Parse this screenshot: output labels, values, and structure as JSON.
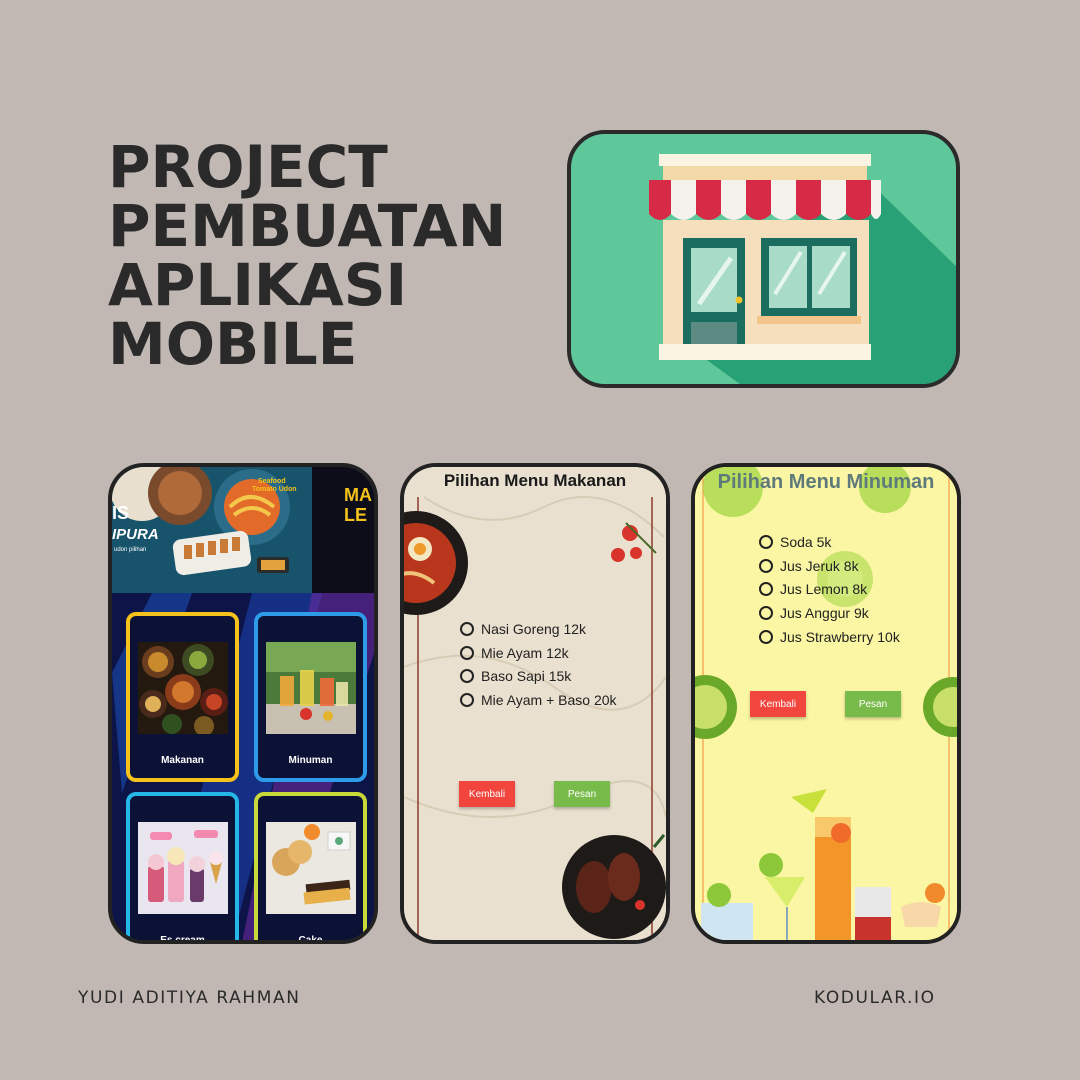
{
  "title": {
    "line1": "PROJECT",
    "line2": "PEMBUATAN",
    "line3": "APLIKASI",
    "line4": "MOBILE"
  },
  "store_icon": "storefront-icon",
  "phone1": {
    "banner_texts": [
      "Seafood Tomato Udon",
      "IS",
      "IPURA",
      "udon pilihan",
      "MA",
      "LE"
    ],
    "tiles": [
      {
        "label": "Makanan",
        "icon": "food-thumbnail",
        "border": "#f4c21a"
      },
      {
        "label": "Minuman",
        "icon": "drink-thumbnail",
        "border": "#2e9be8"
      },
      {
        "label": "Es cream",
        "icon": "ice-cream-thumbnail",
        "border": "#25b7e8"
      },
      {
        "label": "Cake",
        "icon": "cake-thumbnail",
        "border": "#c8d93a"
      }
    ]
  },
  "phone2": {
    "title": "Pilihan Menu Makanan",
    "options": [
      "Nasi Goreng 12k",
      "Mie Ayam 12k",
      "Baso Sapi 15k",
      "Mie Ayam + Baso 20k"
    ],
    "back_label": "Kembali",
    "order_label": "Pesan"
  },
  "phone3": {
    "title": "Pilihan Menu Minuman",
    "options": [
      "Soda 5k",
      "Jus Jeruk 8k",
      "Jus Lemon 8k",
      "Jus Anggur 9k",
      "Jus Strawberry 10k"
    ],
    "back_label": "Kembali",
    "order_label": "Pesan"
  },
  "footer": {
    "author": "YUDI ADITIYA RAHMAN",
    "platform": "KODULAR.IO"
  }
}
